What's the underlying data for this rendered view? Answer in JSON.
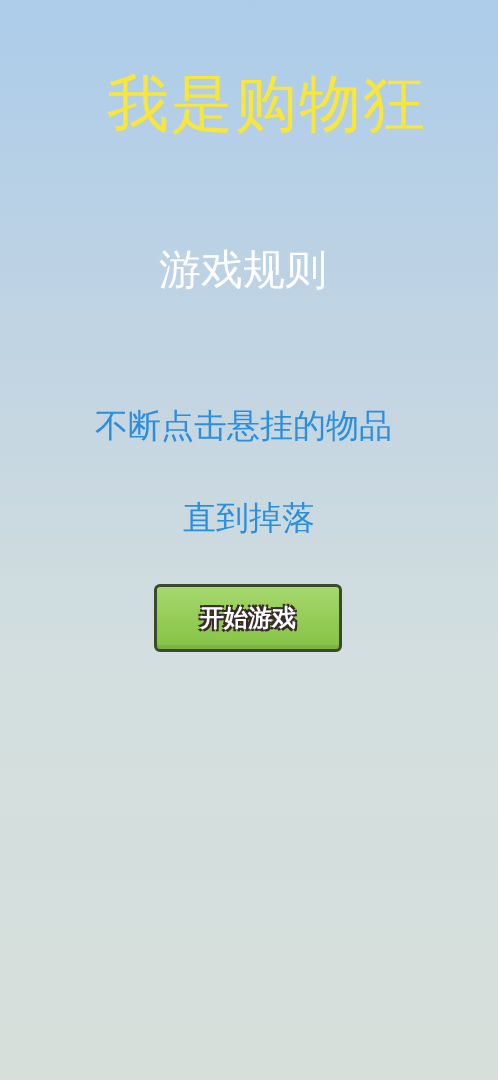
{
  "title": "我是购物狂",
  "rules": {
    "heading": "游戏规则",
    "lines": [
      "不断点击悬挂的物品",
      "直到掉落"
    ]
  },
  "start_button": {
    "label": "开始游戏"
  }
}
